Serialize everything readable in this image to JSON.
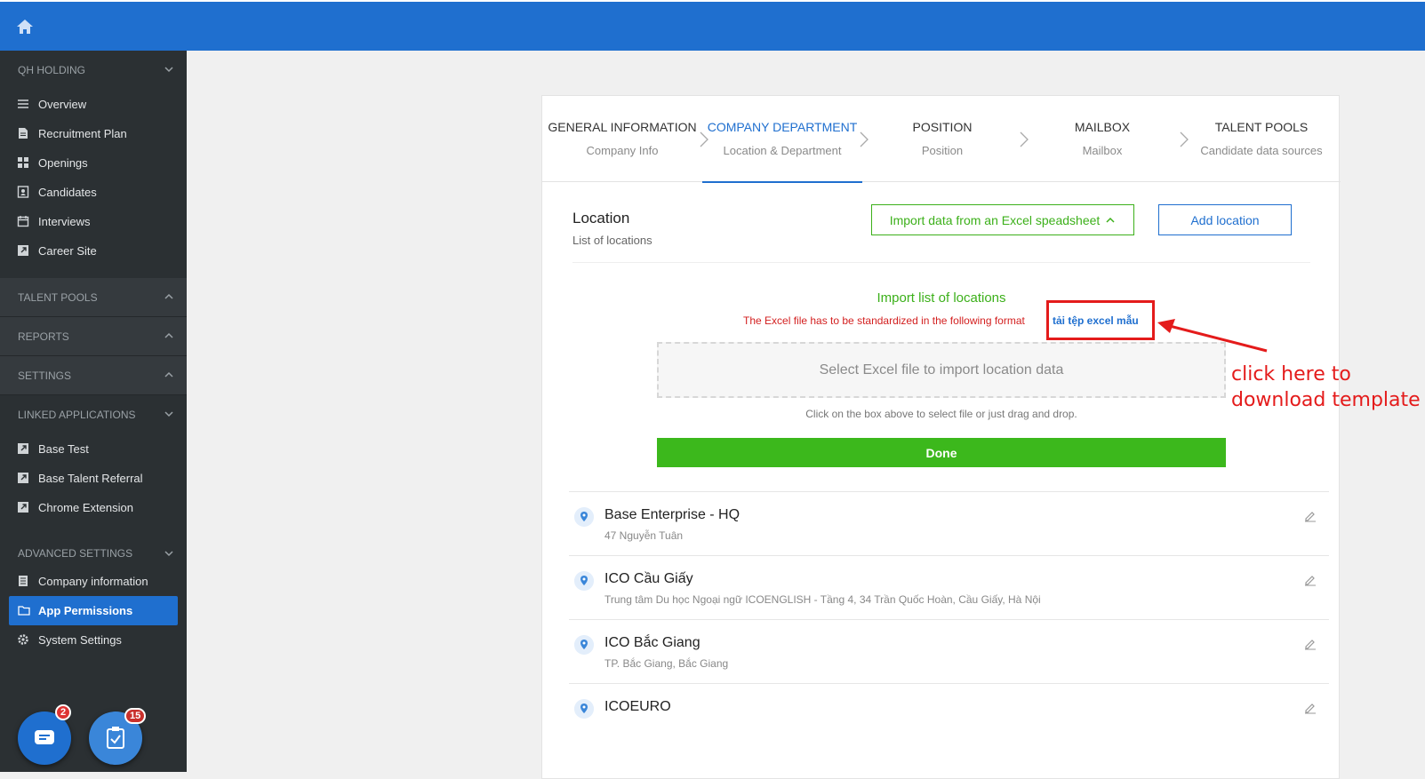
{
  "topbar": {
    "home_icon": "home-icon",
    "color": "#1f6fcf"
  },
  "sidebar": {
    "section_qh": "QH HOLDING",
    "items_main": [
      {
        "label": "Overview",
        "icon": "menu-icon"
      },
      {
        "label": "Recruitment Plan",
        "icon": "document-icon"
      },
      {
        "label": "Openings",
        "icon": "grid-icon"
      },
      {
        "label": "Candidates",
        "icon": "contact-icon"
      },
      {
        "label": "Interviews",
        "icon": "calendar-icon"
      },
      {
        "label": "Career Site",
        "icon": "external-link-icon"
      }
    ],
    "section_talent": "TALENT POOLS",
    "section_reports": "REPORTS",
    "section_settings": "SETTINGS",
    "section_linked": "LINKED APPLICATIONS",
    "items_linked": [
      {
        "label": "Base Test",
        "icon": "external-link-icon"
      },
      {
        "label": "Base Talent Referral",
        "icon": "external-link-icon"
      },
      {
        "label": "Chrome Extension",
        "icon": "external-link-icon"
      }
    ],
    "section_advanced": "ADVANCED SETTINGS",
    "items_advanced": [
      {
        "label": "Company information",
        "icon": "document-icon"
      },
      {
        "label": "App Permissions",
        "icon": "folder-icon",
        "active": true
      },
      {
        "label": "System Settings",
        "icon": "gear-icon"
      }
    ],
    "fab_chat_badge": "2",
    "fab_tasks_badge": "15"
  },
  "steps": [
    {
      "title": "GENERAL INFORMATION",
      "subtitle": "Company Info"
    },
    {
      "title": "COMPANY DEPARTMENT",
      "subtitle": "Location & Department",
      "active": true
    },
    {
      "title": "POSITION",
      "subtitle": "Position"
    },
    {
      "title": "MAILBOX",
      "subtitle": "Mailbox"
    },
    {
      "title": "TALENT POOLS",
      "subtitle": "Candidate data sources"
    }
  ],
  "location": {
    "title": "Location",
    "subtitle": "List of locations",
    "import_button": "Import data from an Excel speadsheet",
    "add_button": "Add location"
  },
  "import": {
    "title": "Import list of locations",
    "note": "The Excel file has to be standardized in the following format",
    "template_link": "tải tệp excel mẫu",
    "dropzone": "Select Excel file to import location data",
    "help": "Click on the box above to select file or just drag and drop.",
    "done": "Done"
  },
  "locations": [
    {
      "name": "Base Enterprise - HQ",
      "address": "47 Nguyễn Tuân"
    },
    {
      "name": "ICO Cầu Giấy",
      "address": "Trung tâm Du học Ngoại ngữ ICOENGLISH - Tầng 4, 34 Trần Quốc Hoàn, Cầu Giấy, Hà Nội"
    },
    {
      "name": "ICO Bắc Giang",
      "address": "TP. Bắc Giang, Bắc Giang"
    },
    {
      "name": "ICOEURO",
      "address": ""
    }
  ],
  "annotation": {
    "line1": "click here to",
    "line2": "download template",
    "color": "#e41b1b"
  }
}
